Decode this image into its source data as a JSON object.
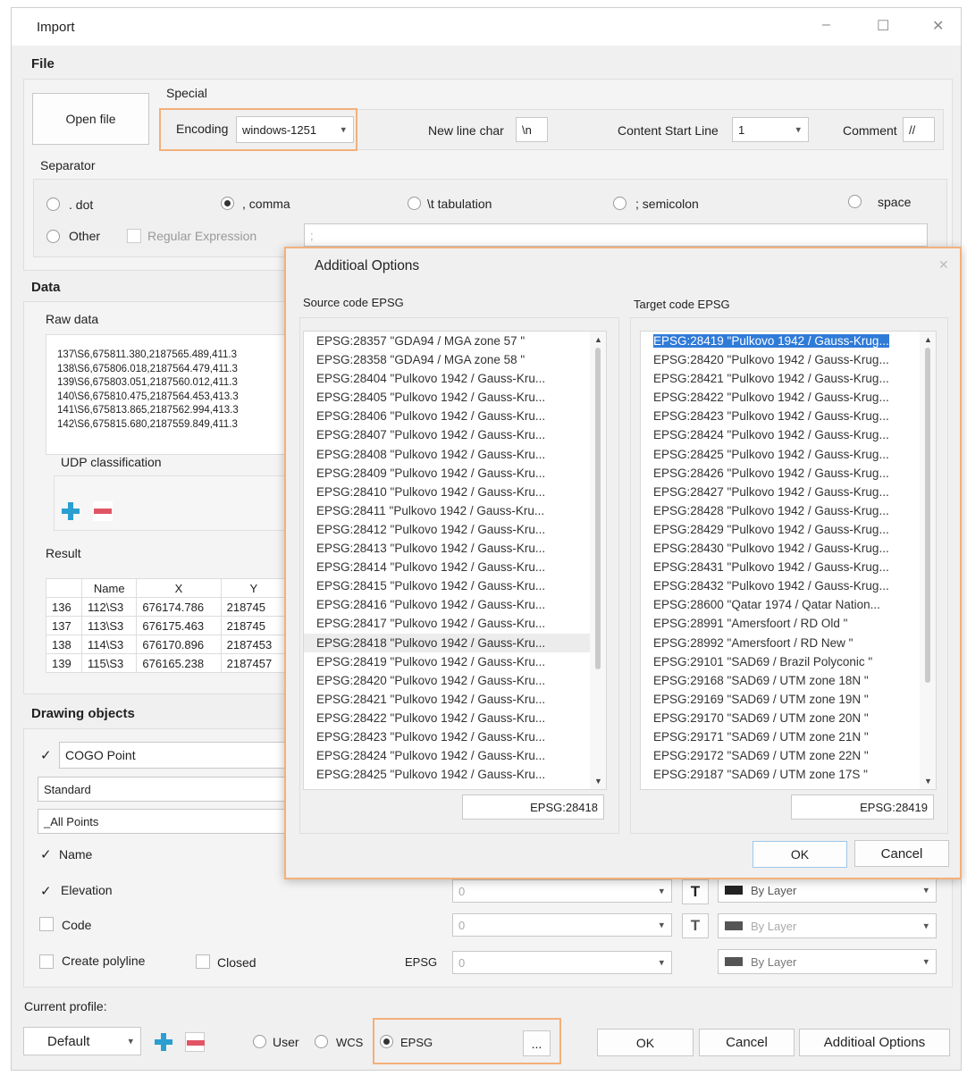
{
  "window": {
    "title": "Import",
    "min": "–",
    "max": "☐",
    "close": "✕"
  },
  "file": {
    "section": "File",
    "open_button": "Open file",
    "special_label": "Special",
    "encoding_label": "Encoding",
    "encoding_value": "windows-1251",
    "newline_label": "New line char",
    "newline_value": "\\n",
    "content_start_label": "Content Start Line",
    "content_start_value": "1",
    "comment_label": "Comment",
    "comment_value": "//",
    "separator_label": "Separator",
    "separators": [
      ". dot",
      ", comma",
      "\\t tabulation",
      "; semicolon",
      "space",
      "Other"
    ],
    "selected_separator": ", comma",
    "regex_label": "Regular Expression",
    "regex_value": ";"
  },
  "data": {
    "section": "Data",
    "raw_label": "Raw data",
    "raw_lines": [
      "137\\S6,675811.380,2187565.489,411.3",
      "138\\S6,675806.018,2187564.479,411.3",
      "139\\S6,675803.051,2187560.012,411.3",
      "140\\S6,675810.475,2187564.453,413.3",
      "141\\S6,675813.865,2187562.994,413.3",
      "142\\S6,675815.680,2187559.849,411.3"
    ],
    "udp_label": "UDP classification",
    "result_label": "Result",
    "result_headers": [
      "",
      "Name",
      "X",
      "Y"
    ],
    "result_rows": [
      [
        "136",
        "112\\S3",
        "676174.786",
        "218745"
      ],
      [
        "137",
        "113\\S3",
        "676175.463",
        "218745"
      ],
      [
        "138",
        "114\\S3",
        "676170.896",
        "2187453"
      ],
      [
        "139",
        "115\\S3",
        "676165.238",
        "2187457"
      ]
    ]
  },
  "drawing": {
    "section": "Drawing objects",
    "type_value": "COGO Point",
    "style_value": "Standard",
    "group_value": "_All Points",
    "name_label": "Name",
    "elevation_label": "Elevation",
    "code_label": "Code",
    "polyline_label": "Create polyline",
    "closed_label": "Closed",
    "epsg_label": "EPSG",
    "num_value": "0",
    "layer_value": "By Layer",
    "t_icon": "T"
  },
  "profile": {
    "label": "Current profile:",
    "value": "Default",
    "user_label": "User",
    "wcs_label": "WCS",
    "epsg_label": "EPSG",
    "dots": "...",
    "ok": "OK",
    "cancel": "Cancel",
    "additional": "Additioal Options"
  },
  "dialog": {
    "title": "Additioal Options",
    "close": "✕",
    "source_label": "Source code EPSG",
    "target_label": "Target code EPSG",
    "source_items": [
      "EPSG:28357  \"GDA94 / MGA zone 57 \"",
      "EPSG:28358  \"GDA94 / MGA zone 58 \"",
      "EPSG:28404  \"Pulkovo 1942 / Gauss-Kru...",
      "EPSG:28405  \"Pulkovo 1942 / Gauss-Kru...",
      "EPSG:28406  \"Pulkovo 1942 / Gauss-Kru...",
      "EPSG:28407  \"Pulkovo 1942 / Gauss-Kru...",
      "EPSG:28408  \"Pulkovo 1942 / Gauss-Kru...",
      "EPSG:28409  \"Pulkovo 1942 / Gauss-Kru...",
      "EPSG:28410  \"Pulkovo 1942 / Gauss-Kru...",
      "EPSG:28411  \"Pulkovo 1942 / Gauss-Kru...",
      "EPSG:28412  \"Pulkovo 1942 / Gauss-Kru...",
      "EPSG:28413  \"Pulkovo 1942 / Gauss-Kru...",
      "EPSG:28414  \"Pulkovo 1942 / Gauss-Kru...",
      "EPSG:28415  \"Pulkovo 1942 / Gauss-Kru...",
      "EPSG:28416  \"Pulkovo 1942 / Gauss-Kru...",
      "EPSG:28417  \"Pulkovo 1942 / Gauss-Kru...",
      "EPSG:28418  \"Pulkovo 1942 / Gauss-Kru...",
      "EPSG:28419  \"Pulkovo 1942 / Gauss-Kru...",
      "EPSG:28420  \"Pulkovo 1942 / Gauss-Kru...",
      "EPSG:28421  \"Pulkovo 1942 / Gauss-Kru...",
      "EPSG:28422  \"Pulkovo 1942 / Gauss-Kru...",
      "EPSG:28423  \"Pulkovo 1942 / Gauss-Kru...",
      "EPSG:28424  \"Pulkovo 1942 / Gauss-Kru...",
      "EPSG:28425  \"Pulkovo 1942 / Gauss-Kru..."
    ],
    "target_items": [
      "EPSG:28419  \"Pulkovo 1942 / Gauss-Krug...",
      "EPSG:28420  \"Pulkovo 1942 / Gauss-Krug...",
      "EPSG:28421  \"Pulkovo 1942 / Gauss-Krug...",
      "EPSG:28422  \"Pulkovo 1942 / Gauss-Krug...",
      "EPSG:28423  \"Pulkovo 1942 / Gauss-Krug...",
      "EPSG:28424  \"Pulkovo 1942 / Gauss-Krug...",
      "EPSG:28425  \"Pulkovo 1942 / Gauss-Krug...",
      "EPSG:28426  \"Pulkovo 1942 / Gauss-Krug...",
      "EPSG:28427  \"Pulkovo 1942 / Gauss-Krug...",
      "EPSG:28428  \"Pulkovo 1942 / Gauss-Krug...",
      "EPSG:28429  \"Pulkovo 1942 / Gauss-Krug...",
      "EPSG:28430  \"Pulkovo 1942 / Gauss-Krug...",
      "EPSG:28431  \"Pulkovo 1942 / Gauss-Krug...",
      "EPSG:28432  \"Pulkovo 1942 / Gauss-Krug...",
      "EPSG:28600  \"Qatar 1974 / Qatar Nation...",
      "EPSG:28991  \"Amersfoort / RD Old \"",
      "EPSG:28992  \"Amersfoort / RD New \"",
      "EPSG:29101  \"SAD69 / Brazil Polyconic \"",
      "EPSG:29168  \"SAD69 / UTM zone 18N \"",
      "EPSG:29169  \"SAD69 / UTM zone 19N \"",
      "EPSG:29170  \"SAD69 / UTM zone 20N \"",
      "EPSG:29171  \"SAD69 / UTM zone 21N \"",
      "EPSG:29172  \"SAD69 / UTM zone 22N \"",
      "EPSG:29187  \"SAD69 / UTM zone 17S \""
    ],
    "source_value": "EPSG:28418",
    "target_value": "EPSG:28419",
    "ok": "OK",
    "cancel": "Cancel"
  }
}
